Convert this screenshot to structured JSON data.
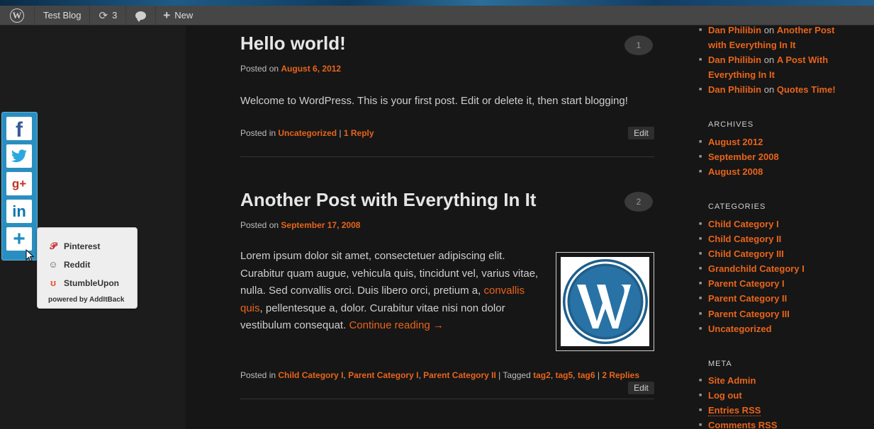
{
  "admin_bar": {
    "site_title": "Test Blog",
    "updates_count": "3",
    "new_label": "New"
  },
  "share": {
    "popup_items": [
      "Pinterest",
      "Reddit",
      "StumbleUpon"
    ],
    "powered_by": "powered by AddItBack"
  },
  "posts": [
    {
      "title": "Hello world!",
      "posted_on_label": "Posted on",
      "date": "August 6, 2012",
      "comment_count": "1",
      "body": "Welcome to WordPress. This is your first post. Edit or delete it, then start blogging!",
      "posted_in_label": "Posted in",
      "categories": [
        "Uncategorized"
      ],
      "sep": " | ",
      "replies": "1 Reply",
      "edit": "Edit"
    },
    {
      "title": "Another Post with Everything In It",
      "posted_on_label": "Posted on",
      "date": "September 17, 2008",
      "comment_count": "2",
      "body_lines": [
        "Lorem ipsum dolor sit amet, consectetuer adipiscing elit.",
        "Curabitur quam augue, vehicula quis, tincidunt vel, varius vitae,",
        "nulla. Sed convallis orci. Duis libero orci, pretium a,",
        "convallis",
        "quis",
        ", pellentesque a, dolor. Curabitur vitae nisi non dolor",
        "vestibulum consequat."
      ],
      "continue_reading": "Continue reading →",
      "posted_in_label": "Posted in",
      "categories": [
        "Child Category I",
        "Parent Category I",
        "Parent Category II"
      ],
      "tagged_label": "Tagged",
      "tags": [
        "tag2",
        "tag5",
        "tag6"
      ],
      "replies": "2 Replies",
      "edit": "Edit"
    }
  ],
  "sidebar": {
    "recent_comments": [
      {
        "author": "Dan Philibin",
        "on": "on",
        "post": "Another Post with Everything In It"
      },
      {
        "author": "Dan Philibin",
        "on": "on",
        "post": "A Post With Everything In It"
      },
      {
        "author": "Dan Philibin",
        "on": "on",
        "post": "Quotes Time!"
      }
    ],
    "archives_title": "ARCHIVES",
    "archives": [
      "August 2012",
      "September 2008",
      "August 2008"
    ],
    "categories_title": "CATEGORIES",
    "categories": [
      "Child Category I",
      "Child Category II",
      "Child Category III",
      "Grandchild Category I",
      "Parent Category I",
      "Parent Category II",
      "Parent Category III",
      "Uncategorized"
    ],
    "meta_title": "META",
    "meta": [
      "Site Admin",
      "Log out",
      "Entries RSS",
      "Comments RSS"
    ]
  },
  "colors": {
    "accent": "#e8641b",
    "background": "#161616",
    "share_bar": "#2a8fc0"
  }
}
